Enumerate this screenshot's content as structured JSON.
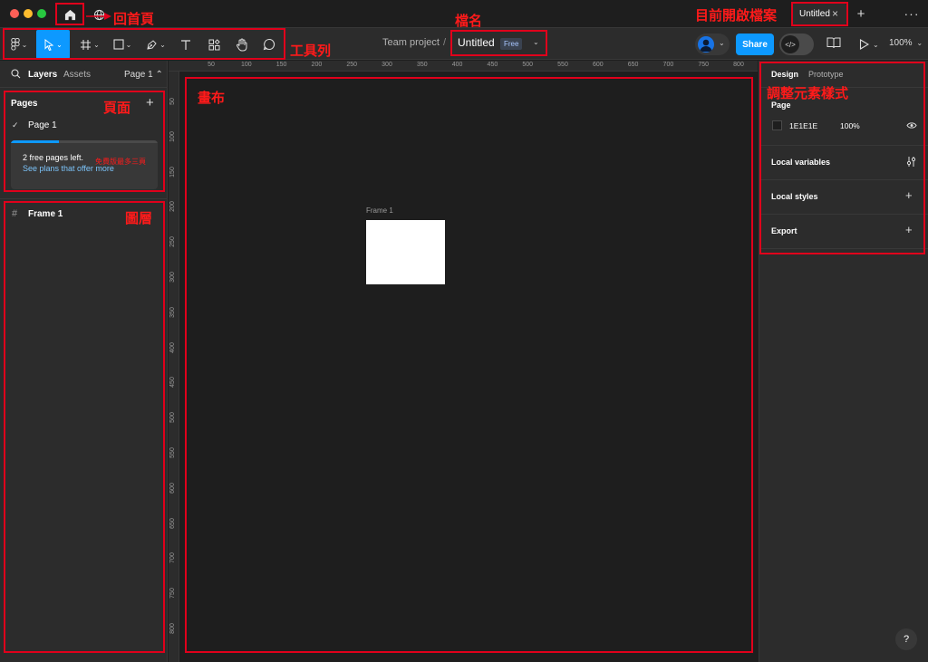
{
  "titlebar": {
    "file_tab": "Untitled",
    "file_tab_close": "×",
    "new_tab": "+",
    "more": "···"
  },
  "toolbar": {
    "breadcrumb_team": "Team project",
    "breadcrumb_sep": "/",
    "file_name": "Untitled",
    "plan_badge": "Free",
    "share_label": "Share",
    "zoom_level": "100%",
    "tools": [
      "main-menu",
      "move",
      "frame",
      "shape",
      "pen",
      "text",
      "resources",
      "hand",
      "comment"
    ]
  },
  "left_panel": {
    "tab_layers": "Layers",
    "tab_assets": "Assets",
    "page_selector": "Page 1 ⌃",
    "pages_title": "Pages",
    "pages_add": "+",
    "pages": [
      {
        "name": "Page 1",
        "selected": true
      }
    ],
    "upsell_line1": "2 free pages left.",
    "upsell_line2": "See plans that offer more",
    "upsell_progress": 0.33,
    "layers": [
      {
        "name": "Frame 1",
        "icon": "frame-hash-icon"
      }
    ]
  },
  "rulers": {
    "x_ticks": [
      "50",
      "100",
      "150",
      "200",
      "250",
      "300",
      "350",
      "400",
      "450",
      "500",
      "550",
      "600",
      "650",
      "700",
      "750",
      "800"
    ],
    "y_ticks": [
      "50",
      "100",
      "150",
      "200",
      "250",
      "300",
      "350",
      "400",
      "450",
      "500",
      "550",
      "600",
      "650",
      "700",
      "750",
      "800"
    ]
  },
  "canvas": {
    "frame_label": "Frame 1",
    "frame_fill": "#FFFFFF",
    "background": "#1E1E1E"
  },
  "right_panel": {
    "tab_design": "Design",
    "tab_prototype": "Prototype",
    "page_title": "Page",
    "page_color_hex": "1E1E1E",
    "page_opacity": "100%",
    "local_variables": "Local variables",
    "local_styles": "Local styles",
    "local_styles_add": "+",
    "export": "Export",
    "export_add": "+"
  },
  "help": "?",
  "annotations": {
    "home": "回首頁",
    "toolbar": "工具列",
    "file_name": "檔名",
    "current_file": "目前開啟檔案",
    "pages": "頁面",
    "pages_note": "免費版最多三頁",
    "layers": "圖層",
    "canvas": "畫布",
    "styles": "調整元素樣式"
  },
  "colors": {
    "accent": "#0D99FF",
    "annotation": "#E0001B",
    "panel": "#2C2C2C",
    "canvas": "#1E1E1E"
  }
}
